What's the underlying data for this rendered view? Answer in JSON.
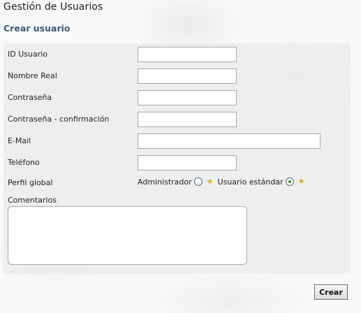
{
  "page": {
    "title": "Gestión de Usuarios",
    "section_title": "Crear usuario"
  },
  "form": {
    "fields": [
      {
        "label": "ID Usuario",
        "value": ""
      },
      {
        "label": "Nombre Real",
        "value": ""
      },
      {
        "label": "Contraseña",
        "value": ""
      },
      {
        "label": "Contraseña - confirmación",
        "value": ""
      },
      {
        "label": "E-Mail",
        "value": ""
      },
      {
        "label": "Teléfono",
        "value": ""
      }
    ],
    "profile": {
      "label": "Perfil global",
      "options": [
        {
          "label": "Administrador",
          "selected": false,
          "icon": "star-icon"
        },
        {
          "label": "Usuario estándar",
          "selected": true,
          "icon": "star-icon"
        }
      ]
    },
    "comments": {
      "label": "Comentarios",
      "value": ""
    },
    "submit_label": "Crear"
  },
  "colors": {
    "section_title": "#3c5978",
    "row_background": "#ececec",
    "star": "#d9b400"
  }
}
